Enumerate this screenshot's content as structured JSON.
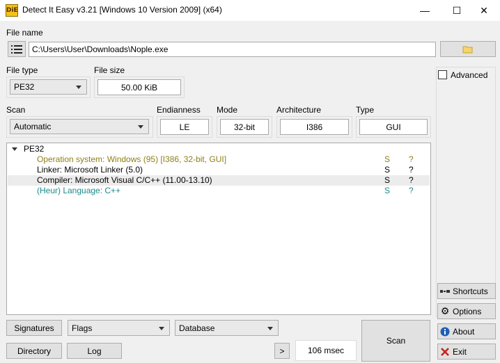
{
  "window": {
    "title": "Detect It Easy v3.21 [Windows 10 Version 2009] (x64)",
    "app_icon_text": "DiE",
    "minimize_glyph": "—",
    "maximize_glyph": "☐",
    "close_glyph": "✕"
  },
  "file": {
    "label": "File name",
    "path": "C:\\Users\\User\\Downloads\\Nople.exe",
    "browse_icon": "folder-icon",
    "menu_icon": "list-icon"
  },
  "file_type": {
    "label": "File type",
    "value": "PE32"
  },
  "file_size": {
    "label": "File size",
    "value": "50.00 KiB"
  },
  "advanced": {
    "label": "Advanced",
    "checked": false
  },
  "scan": {
    "label": "Scan",
    "value": "Automatic"
  },
  "endianness": {
    "label": "Endianness",
    "value": "LE"
  },
  "mode": {
    "label": "Mode",
    "value": "32-bit"
  },
  "architecture": {
    "label": "Architecture",
    "value": "I386"
  },
  "type": {
    "label": "Type",
    "value": "GUI"
  },
  "results": {
    "root": "PE32",
    "rows": [
      {
        "text": "Operation system: Windows (95) [I386, 32-bit, GUI]",
        "s": "S",
        "q": "?",
        "color": "#8f7f16"
      },
      {
        "text": "Linker: Microsoft Linker (5.0)",
        "s": "S",
        "q": "?",
        "color": "#000000"
      },
      {
        "text": "Compiler: Microsoft Visual C/C++ (11.00-13.10)",
        "s": "S",
        "q": "?",
        "color": "#000000"
      },
      {
        "text": "(Heur) Language: C++",
        "s": "S",
        "q": "?",
        "color": "#1a8a8a"
      }
    ]
  },
  "side": {
    "shortcuts": "Shortcuts",
    "options": "Options",
    "about": "About",
    "exit": "Exit"
  },
  "bottom": {
    "signatures": "Signatures",
    "flags": "Flags",
    "database": "Database",
    "directory": "Directory",
    "log": "Log",
    "more": ">",
    "time": "106 msec",
    "scan_button": "Scan"
  }
}
